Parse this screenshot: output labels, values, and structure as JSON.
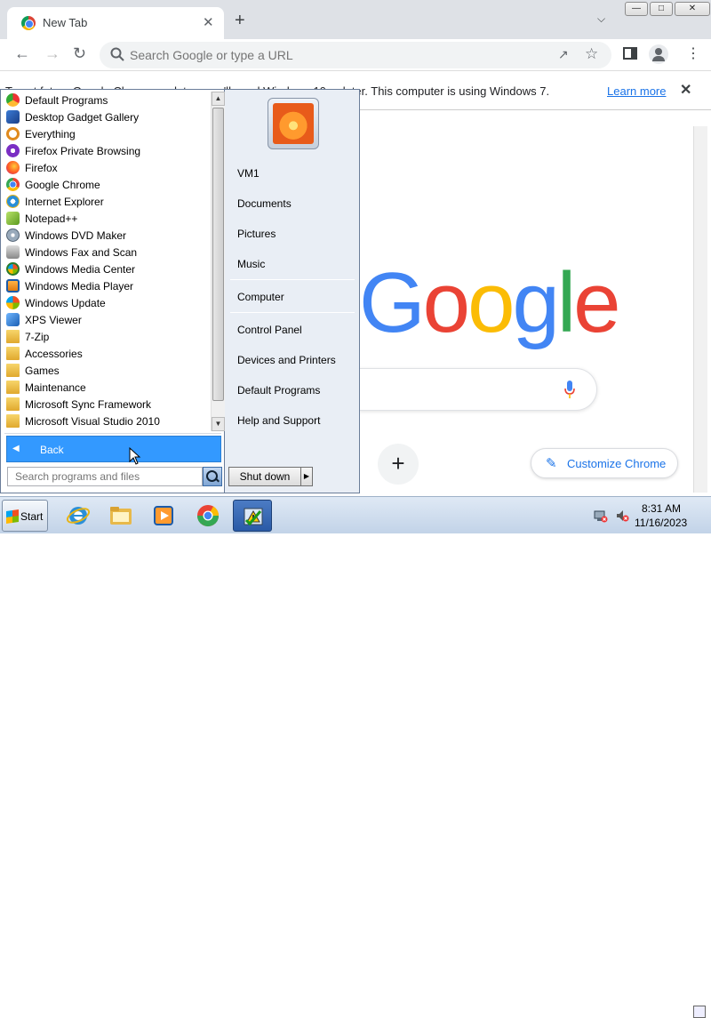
{
  "browser": {
    "tab_title": "New Tab",
    "newtab_symbol": "+",
    "close_symbol": "✕",
    "omnibox_placeholder": "Search Google or type a URL",
    "infobar_message": "To get future Google Chrome updates, you'll need Windows 10 or later. This computer is using Windows 7.",
    "infobar_link": "Learn more",
    "google_letters": [
      "G",
      "o",
      "o",
      "g",
      "l",
      "e"
    ],
    "shortcut_add": "+",
    "customize_label": "Customize Chrome"
  },
  "colors": {
    "google_blue": "#4285f4",
    "google_red": "#ea4335",
    "google_yellow": "#fbbc05",
    "google_green": "#34a853",
    "start_highlight": "#3399ff"
  },
  "start_menu": {
    "programs": [
      {
        "label": "Default Programs",
        "icon": "default-programs-icon"
      },
      {
        "label": "Desktop Gadget Gallery",
        "icon": "gadget-gallery-icon"
      },
      {
        "label": "Everything",
        "icon": "everything-search-icon"
      },
      {
        "label": "Firefox Private Browsing",
        "icon": "firefox-private-icon"
      },
      {
        "label": "Firefox",
        "icon": "firefox-icon"
      },
      {
        "label": "Google Chrome",
        "icon": "chrome-icon"
      },
      {
        "label": "Internet Explorer",
        "icon": "ie-icon"
      },
      {
        "label": "Notepad++",
        "icon": "notepadpp-icon"
      },
      {
        "label": "Windows DVD Maker",
        "icon": "dvd-maker-icon"
      },
      {
        "label": "Windows Fax and Scan",
        "icon": "fax-scan-icon"
      },
      {
        "label": "Windows Media Center",
        "icon": "media-center-icon"
      },
      {
        "label": "Windows Media Player",
        "icon": "media-player-icon"
      },
      {
        "label": "Windows Update",
        "icon": "windows-update-icon"
      },
      {
        "label": "XPS Viewer",
        "icon": "xps-viewer-icon"
      },
      {
        "label": "7-Zip",
        "icon": "folder-icon"
      },
      {
        "label": "Accessories",
        "icon": "folder-icon"
      },
      {
        "label": "Games",
        "icon": "folder-icon"
      },
      {
        "label": "Maintenance",
        "icon": "folder-icon"
      },
      {
        "label": "Microsoft Sync Framework",
        "icon": "folder-icon"
      },
      {
        "label": "Microsoft Visual Studio 2010",
        "icon": "folder-icon"
      }
    ],
    "back_label": "Back",
    "search_placeholder": "Search programs and files",
    "right_items": {
      "user": "VM1",
      "documents": "Documents",
      "pictures": "Pictures",
      "music": "Music",
      "computer": "Computer",
      "control_panel": "Control Panel",
      "devices_printers": "Devices and Printers",
      "default_programs": "Default Programs",
      "help_support": "Help and Support"
    },
    "shutdown_label": "Shut down"
  },
  "taskbar": {
    "start_label": "Start",
    "time": "8:31 AM",
    "date": "11/16/2023"
  }
}
